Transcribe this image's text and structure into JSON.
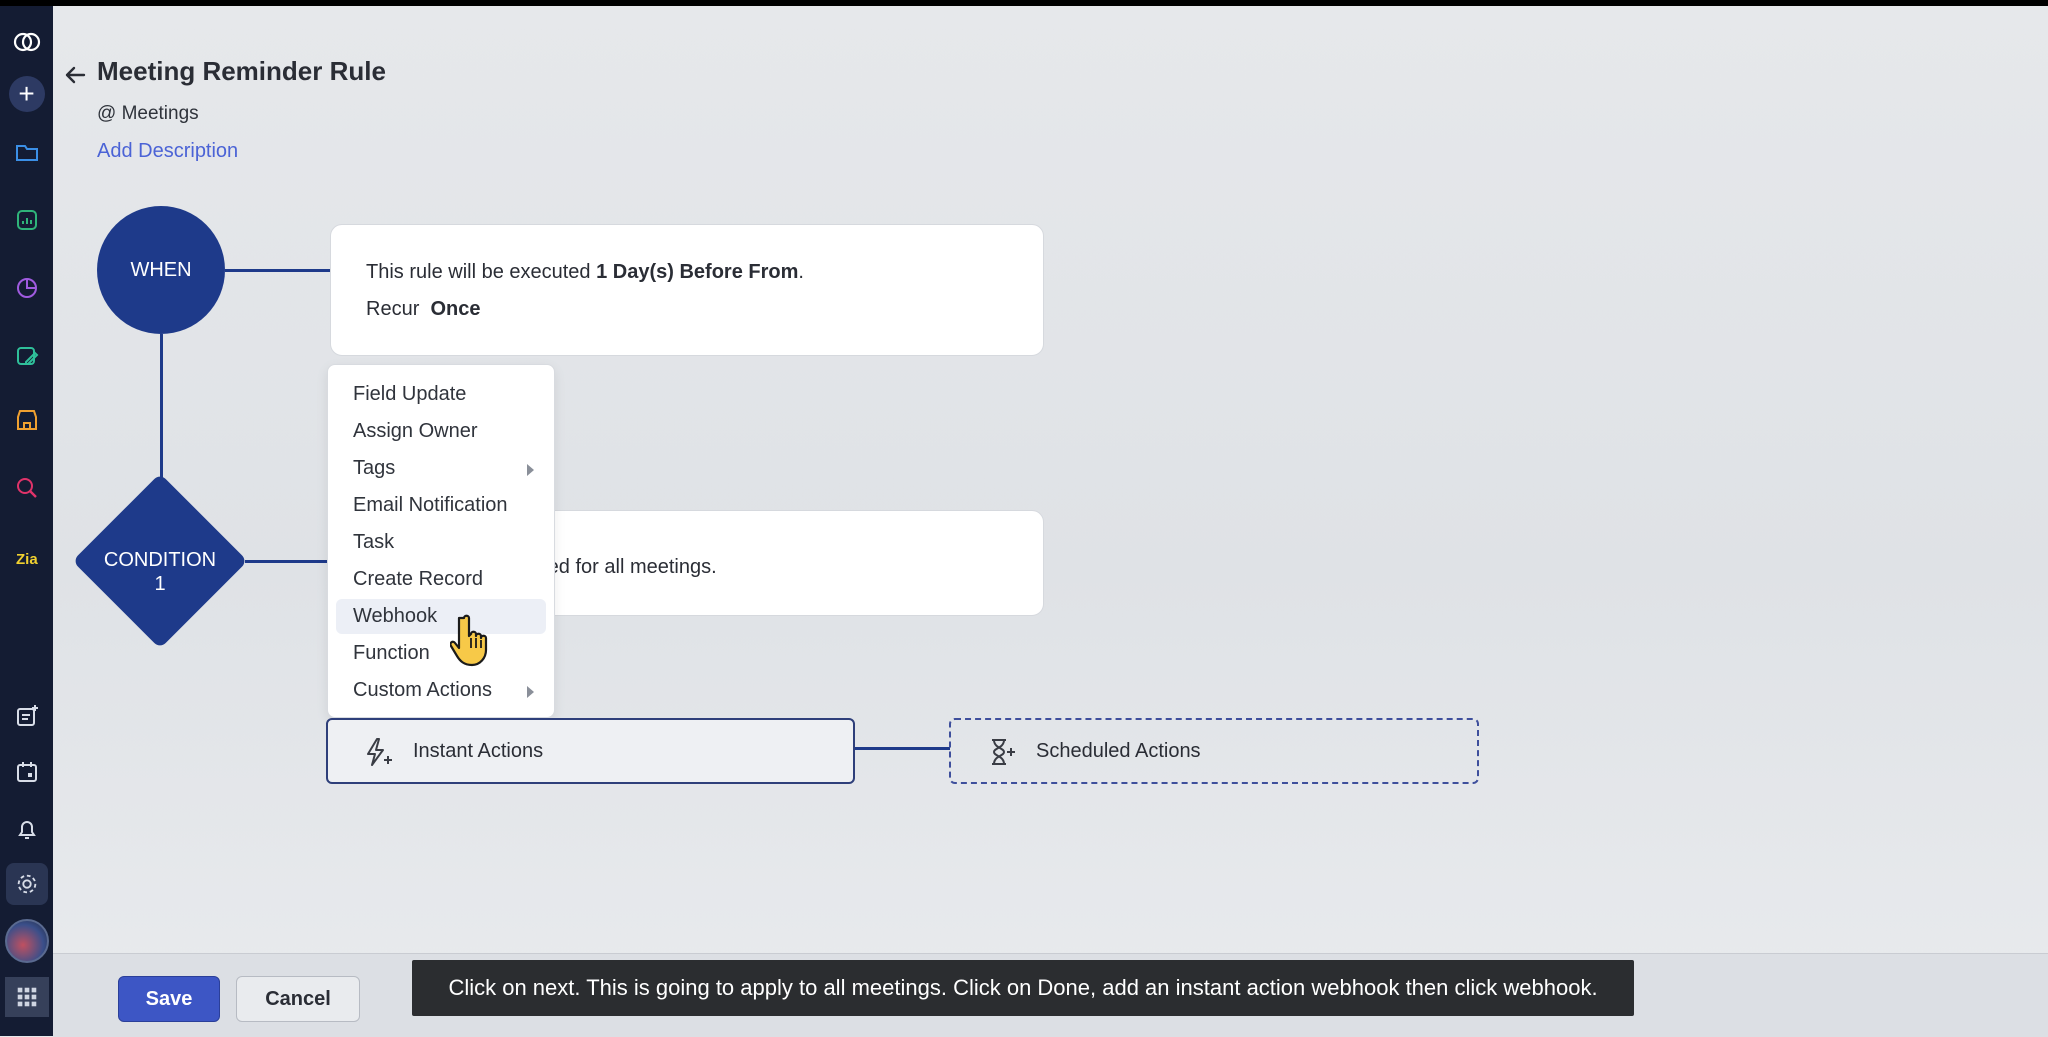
{
  "page": {
    "title": "Meeting Reminder Rule",
    "module": "@ Meetings",
    "add_description": "Add Description"
  },
  "flow": {
    "when_label": "WHEN",
    "when_text_prefix": "This rule will be executed ",
    "when_text_bold": "1 Day(s) Before From",
    "when_text_suffix": ".",
    "recur_label": "Recur",
    "recur_value": "Once",
    "condition_label_line1": "CONDITION",
    "condition_label_line2": "1",
    "condition_text": "uted for all meetings."
  },
  "menu": {
    "items": [
      {
        "label": "Field Update"
      },
      {
        "label": "Assign Owner"
      },
      {
        "label": "Tags"
      },
      {
        "label": "Email Notification"
      },
      {
        "label": "Task"
      },
      {
        "label": "Create Record"
      },
      {
        "label": "Webhook"
      },
      {
        "label": "Function"
      },
      {
        "label": "Custom Actions"
      }
    ],
    "active_item": "Webhook"
  },
  "actions": {
    "instant_label": "Instant Actions",
    "scheduled_label": "Scheduled Actions"
  },
  "footer": {
    "save_label": "Save",
    "cancel_label": "Cancel"
  },
  "caption": "Click on next.  This is going to apply to  all meetings.  Click on Done,  add an instant action webhook then click  webhook.",
  "colors": {
    "sidebar": "#141c33",
    "node": "#1e3a8a",
    "accent_link": "#4b63d6",
    "save": "#3d56c5"
  },
  "icons": {
    "sidebar": [
      "zoho-logo-icon",
      "plus-icon",
      "folder-icon",
      "analytics-icon",
      "pie-chart-icon",
      "calendar-edit-icon",
      "marketplace-icon",
      "search-zoom-icon",
      "zia-icon",
      "note-add-icon",
      "calendar-icon",
      "bell-icon",
      "gear-icon",
      "avatar",
      "apps-grid-icon"
    ]
  }
}
